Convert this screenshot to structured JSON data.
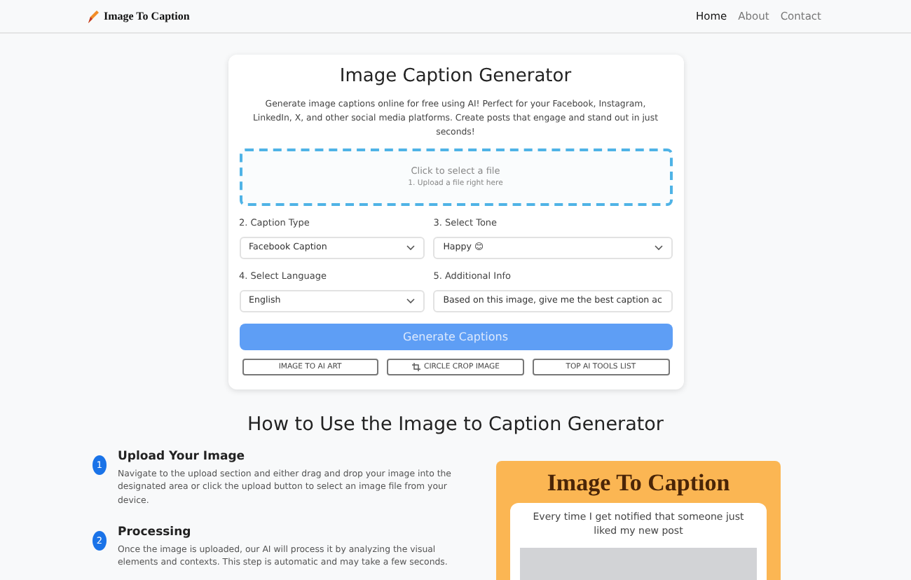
{
  "header": {
    "logo_text": "Image To Caption",
    "nav": [
      {
        "label": "Home",
        "selected": true
      },
      {
        "label": "About",
        "selected": false
      },
      {
        "label": "Contact",
        "selected": false
      }
    ]
  },
  "generator": {
    "title": "Image Caption Generator",
    "description": "Generate image captions online for free using AI! Perfect for your Facebook, Instagram, LinkedIn, X, and other social media platforms. Create posts that engage and stand out in just seconds!",
    "upload": {
      "prompt": "Click to select a file",
      "hint": "1. Upload a file right here"
    },
    "fields": [
      {
        "kind": "select",
        "label": "2. Caption Type",
        "value": "Facebook Caption"
      },
      {
        "kind": "select",
        "label": "3. Select Tone",
        "value": "Happy 😊"
      },
      {
        "kind": "select",
        "label": "4. Select Language",
        "value": "English"
      },
      {
        "kind": "text",
        "label": "5. Additional Info",
        "value": "Based on this image, give me the best caption ac"
      }
    ],
    "generate_button": "Generate Captions",
    "links": [
      {
        "label": "IMAGE TO AI ART",
        "kind": "plain"
      },
      {
        "label": "CIRCLE CROP IMAGE",
        "kind": "crop"
      },
      {
        "label": "TOP AI TOOLS LIST",
        "kind": "plain"
      }
    ]
  },
  "how_to": {
    "title": "How to Use the Image to Caption Generator",
    "steps": [
      {
        "number": "1",
        "title": "Upload Your Image",
        "text": "Navigate to the upload section and either drag and drop your image into the designated area or click the upload button to select an image file from your device."
      },
      {
        "number": "2",
        "title": "Processing",
        "text": "Once the image is uploaded, our AI will process it by analyzing the visual elements and contexts. This step is automatic and may take a few seconds."
      }
    ],
    "preview": {
      "title": "Image To Caption",
      "caption": "Every time I get notified that someone just liked my new post"
    }
  }
}
